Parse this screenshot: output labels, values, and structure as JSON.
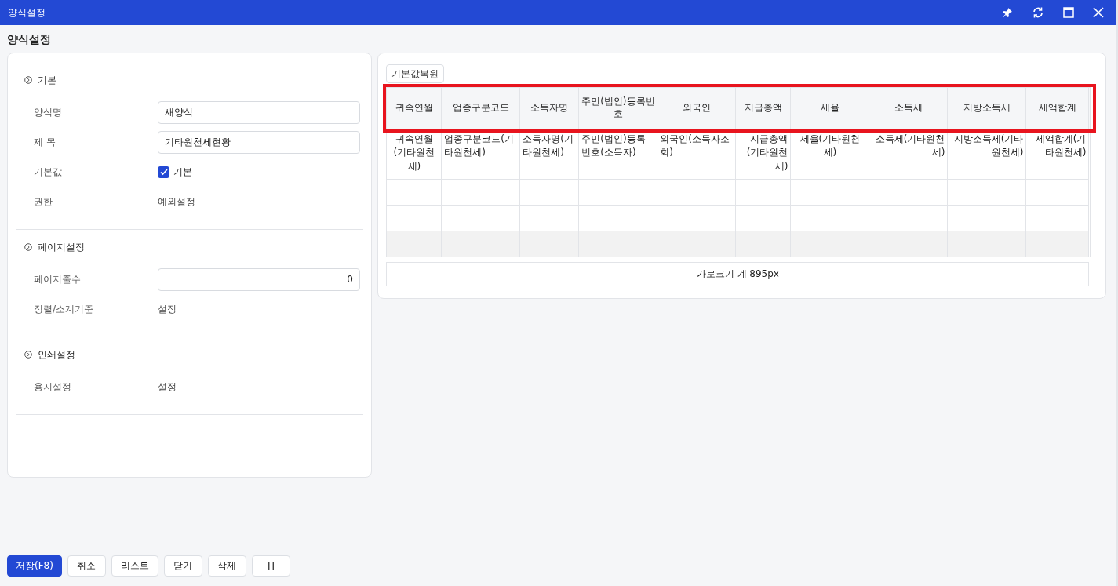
{
  "window": {
    "title": "양식설정"
  },
  "page_title": "양식설정",
  "sections": [
    {
      "title": "기본",
      "rows": [
        {
          "kind": "input",
          "label": "양식명",
          "value": "새양식"
        },
        {
          "kind": "input",
          "label": "제 목",
          "value": "기타원천세현황"
        },
        {
          "kind": "checkbox",
          "label": "기본값",
          "text": "기본",
          "checked": true
        },
        {
          "kind": "link",
          "label": "권한",
          "text": "예외설정"
        }
      ]
    },
    {
      "title": "페이지설정",
      "rows": [
        {
          "kind": "number",
          "label": "페이지줄수",
          "value": "0"
        },
        {
          "kind": "link",
          "label": "정렬/소계기준",
          "text": "설정"
        }
      ]
    },
    {
      "title": "인쇄설정",
      "rows": [
        {
          "kind": "link",
          "label": "용지설정",
          "text": "설정"
        }
      ]
    }
  ],
  "restore_button": "기본값복원",
  "table": {
    "header_highlighted": true,
    "columns": [
      {
        "header": "귀속연월"
      },
      {
        "header": "업종구분코드"
      },
      {
        "header": "소득자명"
      },
      {
        "header": "주민(법인)등록번호"
      },
      {
        "header": "외국인"
      },
      {
        "header": "지급총액"
      },
      {
        "header": "세율"
      },
      {
        "header": "소득세"
      },
      {
        "header": "지방소득세"
      },
      {
        "header": "세액합계"
      }
    ],
    "rows": [
      {
        "kind": "field",
        "cells": [
          "귀속연월(기타원천세)",
          "업종구분코드(기타원천세)",
          "소득자명(기타원천세)",
          "주민(법인)등록번호(소득자)",
          "외국인(소득자조회)",
          "지급총액(기타원천세)",
          "세율(기타원천세)",
          "소득세(기타원천세)",
          "지방소득세(기타원천세)",
          "세액합계(기타원천세)"
        ]
      },
      {
        "kind": "blank"
      },
      {
        "kind": "blank"
      },
      {
        "kind": "total"
      }
    ],
    "width_total": "가로크기 계 895px"
  },
  "buttons": [
    {
      "label": "저장(F8)",
      "primary": true
    },
    {
      "label": "취소",
      "primary": false
    },
    {
      "label": "리스트",
      "primary": false
    },
    {
      "label": "닫기",
      "primary": false
    },
    {
      "label": "삭제",
      "primary": false
    },
    {
      "label": "H",
      "primary": false
    }
  ]
}
